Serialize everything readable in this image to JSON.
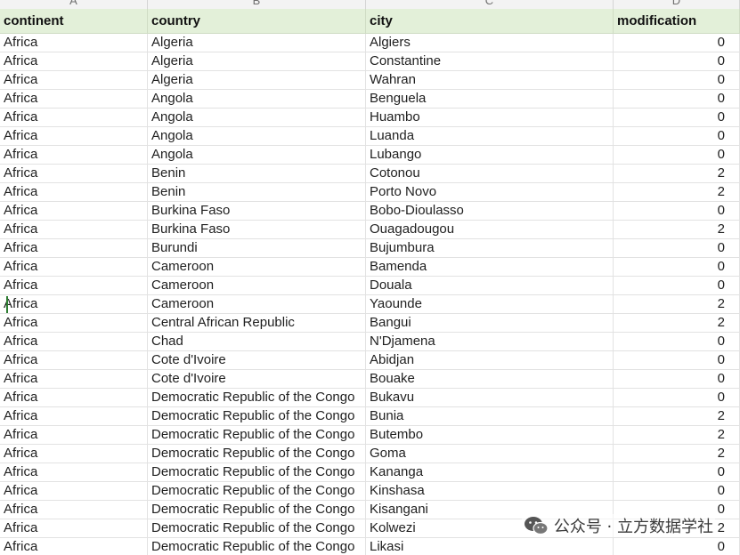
{
  "column_letters": [
    "A",
    "B",
    "C",
    "D"
  ],
  "headers": {
    "continent": "continent",
    "country": "country",
    "city": "city",
    "modification": "modification"
  },
  "rows": [
    {
      "continent": "Africa",
      "country": "Algeria",
      "city": "Algiers",
      "modification": "0"
    },
    {
      "continent": "Africa",
      "country": "Algeria",
      "city": "Constantine",
      "modification": "0"
    },
    {
      "continent": "Africa",
      "country": "Algeria",
      "city": "Wahran",
      "modification": "0"
    },
    {
      "continent": "Africa",
      "country": "Angola",
      "city": "Benguela",
      "modification": "0"
    },
    {
      "continent": "Africa",
      "country": "Angola",
      "city": "Huambo",
      "modification": "0"
    },
    {
      "continent": "Africa",
      "country": "Angola",
      "city": "Luanda",
      "modification": "0"
    },
    {
      "continent": "Africa",
      "country": "Angola",
      "city": "Lubango",
      "modification": "0"
    },
    {
      "continent": "Africa",
      "country": "Benin",
      "city": "Cotonou",
      "modification": "2"
    },
    {
      "continent": "Africa",
      "country": "Benin",
      "city": "Porto Novo",
      "modification": "2"
    },
    {
      "continent": "Africa",
      "country": "Burkina Faso",
      "city": "Bobo-Dioulasso",
      "modification": "0"
    },
    {
      "continent": "Africa",
      "country": "Burkina Faso",
      "city": "Ouagadougou",
      "modification": "2"
    },
    {
      "continent": "Africa",
      "country": "Burundi",
      "city": "Bujumbura",
      "modification": "0"
    },
    {
      "continent": "Africa",
      "country": "Cameroon",
      "city": "Bamenda",
      "modification": "0"
    },
    {
      "continent": "Africa",
      "country": "Cameroon",
      "city": "Douala",
      "modification": "0"
    },
    {
      "continent": "Africa",
      "country": "Cameroon",
      "city": "Yaounde",
      "modification": "2"
    },
    {
      "continent": "Africa",
      "country": "Central African Republic",
      "city": "Bangui",
      "modification": "2"
    },
    {
      "continent": "Africa",
      "country": "Chad",
      "city": "N'Djamena",
      "modification": "0"
    },
    {
      "continent": "Africa",
      "country": "Cote d'Ivoire",
      "city": "Abidjan",
      "modification": "0"
    },
    {
      "continent": "Africa",
      "country": "Cote d'Ivoire",
      "city": "Bouake",
      "modification": "0"
    },
    {
      "continent": "Africa",
      "country": "Democratic Republic of the Congo",
      "city": "Bukavu",
      "modification": "0"
    },
    {
      "continent": "Africa",
      "country": "Democratic Republic of the Congo",
      "city": "Bunia",
      "modification": "2"
    },
    {
      "continent": "Africa",
      "country": "Democratic Republic of the Congo",
      "city": "Butembo",
      "modification": "2"
    },
    {
      "continent": "Africa",
      "country": "Democratic Republic of the Congo",
      "city": "Goma",
      "modification": "2"
    },
    {
      "continent": "Africa",
      "country": "Democratic Republic of the Congo",
      "city": "Kananga",
      "modification": "0"
    },
    {
      "continent": "Africa",
      "country": "Democratic Republic of the Congo",
      "city": "Kinshasa",
      "modification": "0"
    },
    {
      "continent": "Africa",
      "country": "Democratic Republic of the Congo",
      "city": "Kisangani",
      "modification": "0"
    },
    {
      "continent": "Africa",
      "country": "Democratic Republic of the Congo",
      "city": "Kolwezi",
      "modification": "2"
    },
    {
      "continent": "Africa",
      "country": "Democratic Republic of the Congo",
      "city": "Likasi",
      "modification": "0"
    }
  ],
  "watermark": {
    "text": "公众号 · 立方数据学社",
    "icon": "wechat-icon"
  },
  "colors": {
    "header_fill": "#e3f0d9",
    "active_marker": "#2e7d32"
  }
}
